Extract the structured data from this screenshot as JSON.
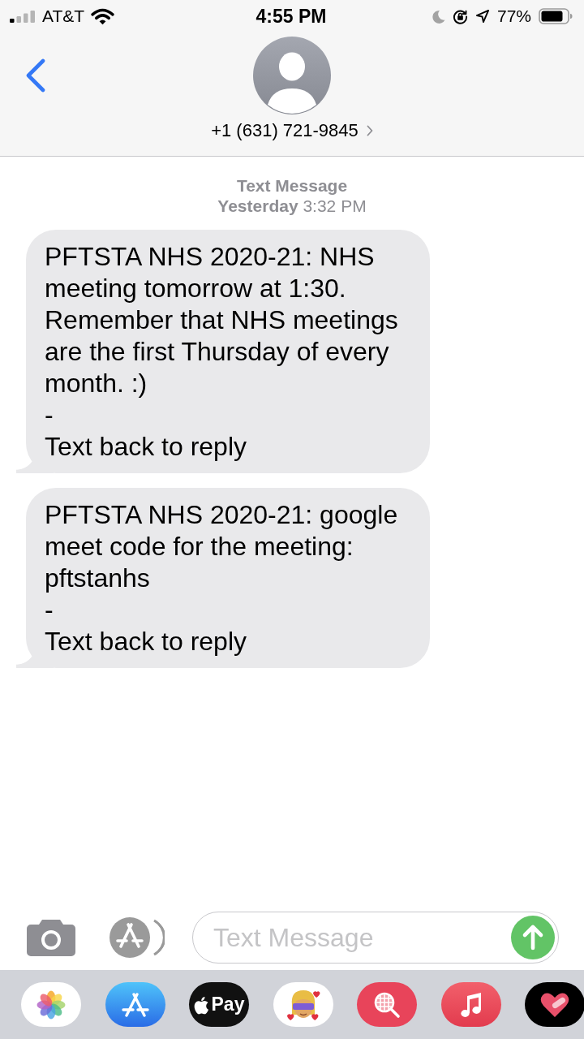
{
  "status_bar": {
    "carrier": "AT&T",
    "time": "4:55 PM",
    "battery": "77%"
  },
  "header": {
    "contact": "+1 (631) 721-9845"
  },
  "thread": {
    "service": "Text Message",
    "timestamp": "**Yesterday** 3:32 PM",
    "messages": [
      {
        "kind": "received",
        "text": "PFTSTA NHS 2020-21: NHS meeting tomorrow at 1:30. Remember that NHS meetings are the first Thursday of every month. :)\n-\nText back to reply"
      },
      {
        "kind": "received",
        "text": "PFTSTA NHS 2020-21: google meet code for the meeting: pftstanhs\n-\nText back to reply"
      }
    ]
  },
  "compose": {
    "placeholder": "Text Message"
  },
  "app_drawer": [
    {
      "kind": "photos"
    },
    {
      "kind": "app_store"
    },
    {
      "kind": "apple_pay",
      "label": "Pay"
    },
    {
      "kind": "memoji"
    },
    {
      "kind": "web_search"
    },
    {
      "kind": "music"
    },
    {
      "kind": "heart"
    }
  ]
}
